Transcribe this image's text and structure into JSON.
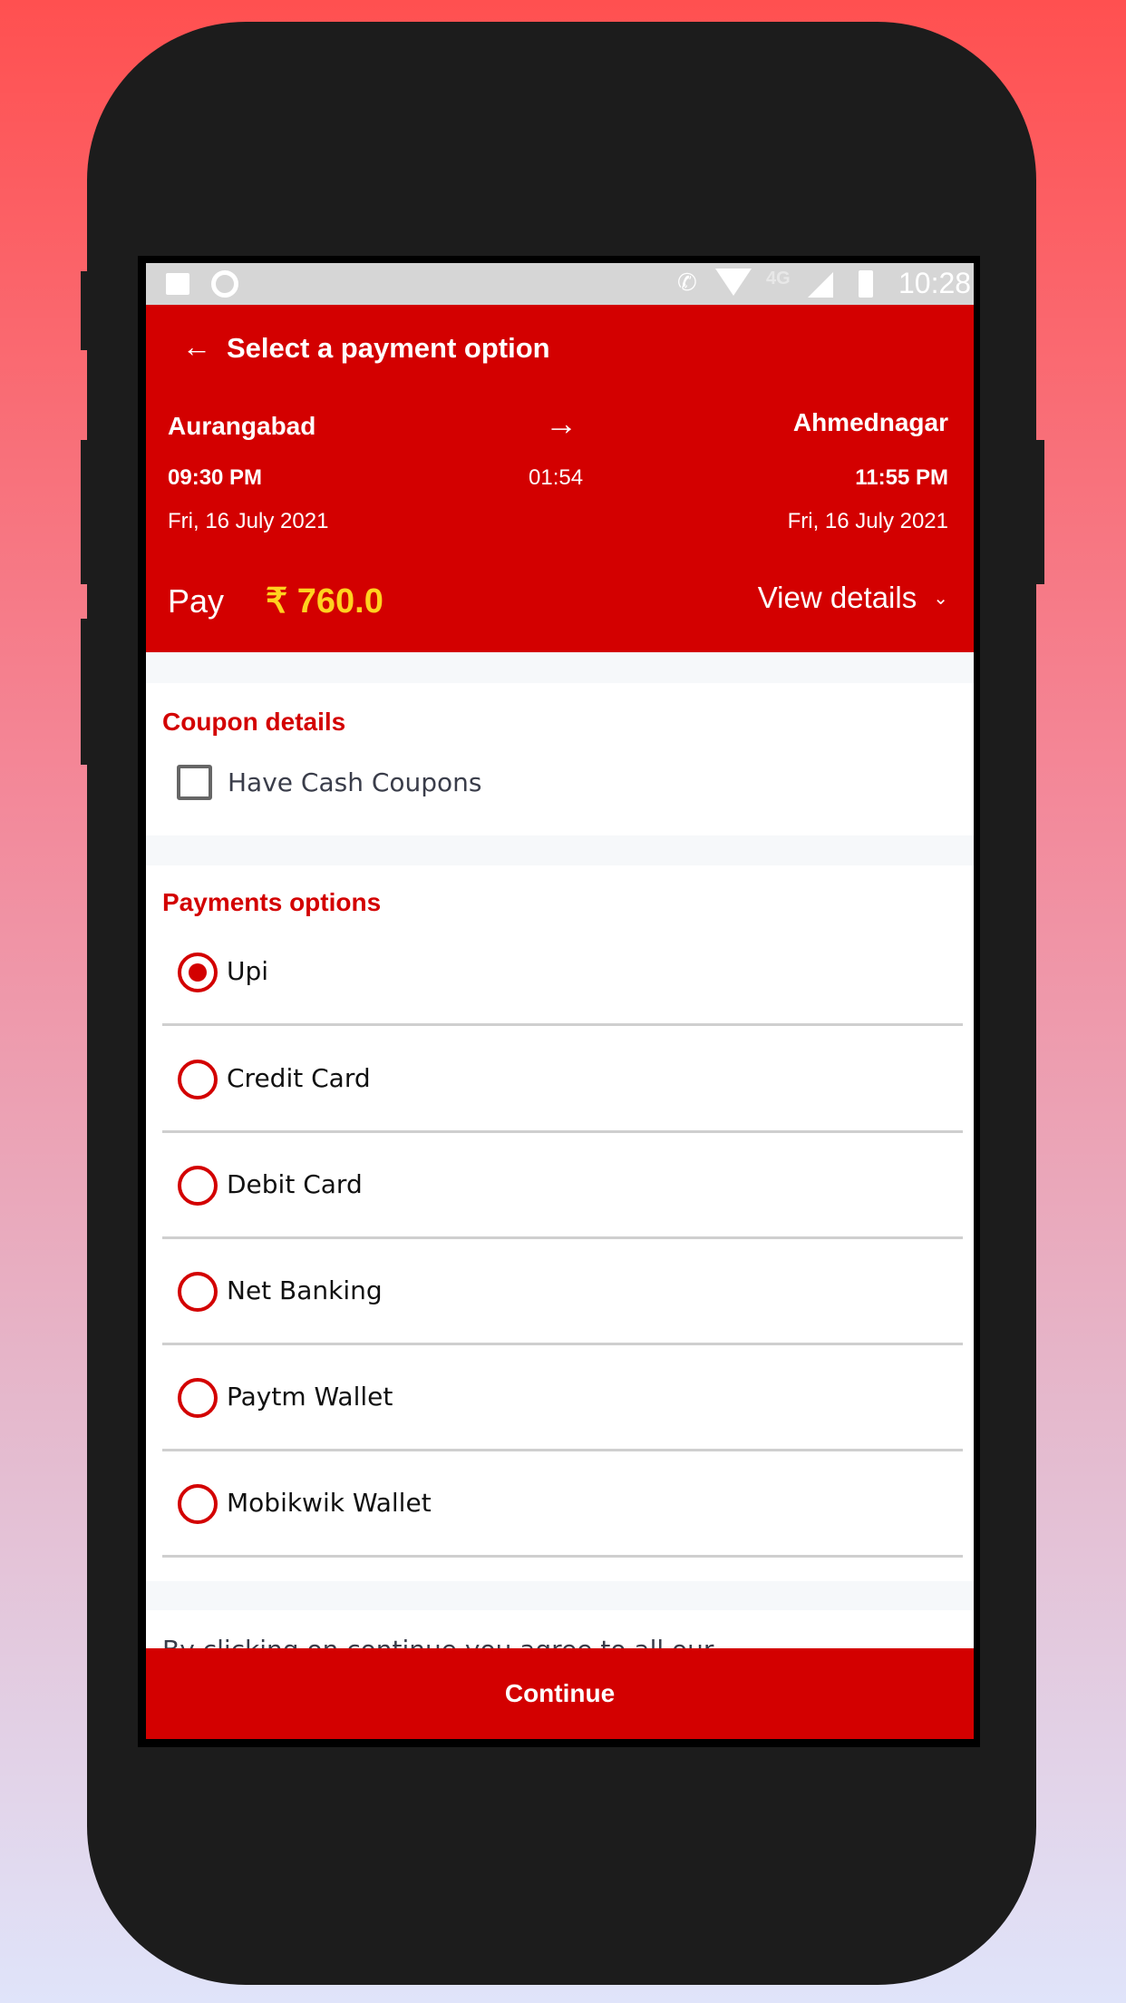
{
  "status_bar": {
    "time": "10:28",
    "network": "4G",
    "icons": [
      "image-icon",
      "circle-icon",
      "wifi-call-icon",
      "wifi-icon",
      "signal-icon",
      "battery-charging-icon"
    ]
  },
  "header": {
    "title": "Select a payment option",
    "back_icon": "arrow-left-icon"
  },
  "journey": {
    "from": "Aurangabad",
    "to": "Ahmednagar",
    "depart_time": "09:30 PM",
    "arrive_time": "11:55 PM",
    "duration": "01:54",
    "depart_date": "Fri, 16 July 2021",
    "arrive_date": "Fri, 16 July 2021"
  },
  "pay": {
    "label": "Pay",
    "amount": "₹ 760.0",
    "view_details": "View details"
  },
  "coupon": {
    "title": "Coupon details",
    "checkbox_label": "Have Cash Coupons",
    "checked": false
  },
  "payments": {
    "title": "Payments options",
    "selected": "Upi",
    "options": [
      {
        "label": "Upi"
      },
      {
        "label": "Credit Card"
      },
      {
        "label": "Debit Card"
      },
      {
        "label": "Net Banking"
      },
      {
        "label": "Paytm Wallet"
      },
      {
        "label": "Mobikwik Wallet"
      }
    ]
  },
  "footer": {
    "terms_text": "By clicking on continue you agree to all our",
    "continue_label": "Continue"
  },
  "colors": {
    "primary": "#d30000",
    "amount": "#ffd21f"
  }
}
